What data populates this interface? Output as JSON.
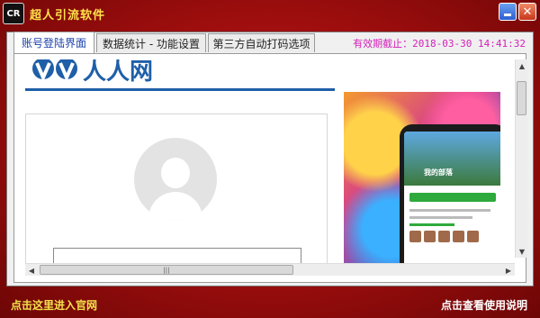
{
  "app": {
    "logo_text": "CR",
    "title": "超人引流软件"
  },
  "window_controls": {
    "minimize_icon": "minimize-icon",
    "close_icon": "close-icon",
    "close_glyph": "✕"
  },
  "tabs": [
    {
      "label": "账号登陆界面",
      "active": true
    },
    {
      "label": "数据统计 - 功能设置",
      "active": false
    },
    {
      "label": "第三方自动打码选项",
      "active": false
    }
  ],
  "expiry": {
    "label": "有效期截止：",
    "value": "2018-03-30 14:41:32"
  },
  "browser": {
    "site_logo": "人人网",
    "ad_card_text": "我的部落"
  },
  "scrollbar": {
    "grip": "|||"
  },
  "footer": {
    "left_link": "点击这里进入官网",
    "right_link": "点击查看使用说明"
  },
  "colors": {
    "accent": "#b01010",
    "title_text": "#ffe14a",
    "expiry_text": "#d21fb8",
    "site_blue": "#1f5fa8"
  }
}
